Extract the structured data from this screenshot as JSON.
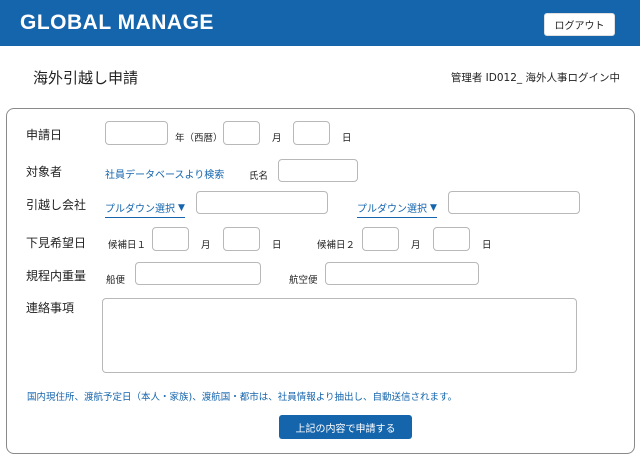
{
  "header": {
    "brand": "GLOBAL MANAGE",
    "logout_label": "ログアウト"
  },
  "page": {
    "title": "海外引越し申請",
    "admin_info": "管理者 ID012_ 海外人事ログイン中"
  },
  "form": {
    "application_date": {
      "label": "申請日",
      "year_label": "年（西暦）",
      "month_label": "月",
      "day_label": "日",
      "year_value": "",
      "month_value": "",
      "day_value": ""
    },
    "target": {
      "label": "対象者",
      "search_link": "社員データベースより検索",
      "name_label": "氏名",
      "name_value": ""
    },
    "moving_company": {
      "label": "引越し会社",
      "dropdown_1": "プルダウン選択",
      "dropdown_2": "プルダウン選択",
      "field_1_value": "",
      "field_2_value": ""
    },
    "preview_date": {
      "label": "下見希望日",
      "candidate_1_label": "候補日１",
      "candidate_2_label": "候補日２",
      "month_label": "月",
      "day_label": "日"
    },
    "weight": {
      "label": "規程内重量",
      "ship_label": "船便",
      "air_label": "航空便",
      "ship_value": "",
      "air_value": ""
    },
    "notes": {
      "label": "連絡事項",
      "value": ""
    },
    "info_note": "国内現住所、渡航予定日（本人・家族)、渡航国・都市は、社員情報より抽出し、自動送信されます。",
    "submit_label": "上記の内容で申請する"
  },
  "colors": {
    "brand_blue": "#1565ad",
    "border_gray": "#b8b8b8"
  },
  "icons": {
    "dropdown": "triangle-down"
  }
}
